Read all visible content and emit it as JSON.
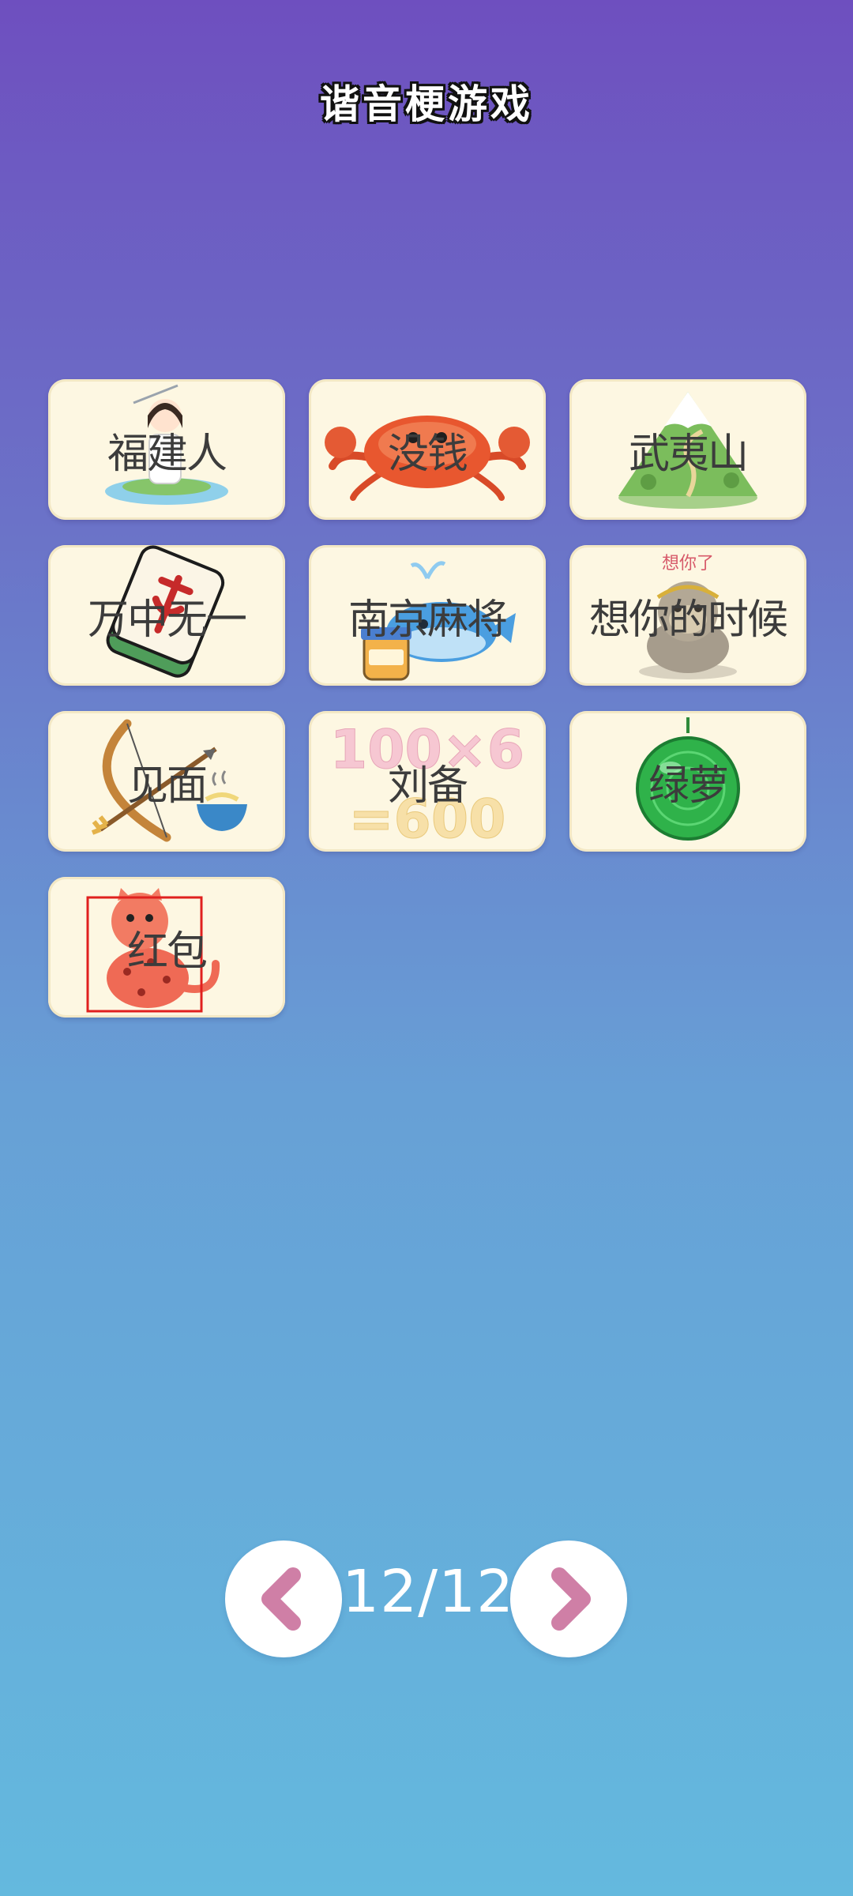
{
  "app": {
    "title": "谐音梗游戏"
  },
  "cards": [
    {
      "label": "福建人",
      "icon": "swordswoman-on-island-icon"
    },
    {
      "label": "没钱",
      "icon": "crab-icon"
    },
    {
      "label": "武夷山",
      "icon": "mountain-icon"
    },
    {
      "label": "万中无一",
      "icon": "mahjong-tile-icon"
    },
    {
      "label": "南京麻将",
      "icon": "whale-sesame-paste-icon"
    },
    {
      "label": "想你的时候",
      "icon": "stone-monkey-icon",
      "picture_text": "想你了"
    },
    {
      "label": "见面",
      "icon": "bow-arrow-noodles-icon"
    },
    {
      "label": "刘备",
      "icon": "math-equation-icon",
      "picture_text": "100×6 =600"
    },
    {
      "label": "绿萝",
      "icon": "green-gong-icon"
    },
    {
      "label": "红包",
      "icon": "red-leopard-icon"
    }
  ],
  "pagination": {
    "indicator": "12/12",
    "prev_icon": "chevron-left-icon",
    "next_icon": "chevron-right-icon"
  },
  "colors": {
    "background_top": "#6e4fbf",
    "background_bottom": "#64b9de",
    "card_background": "#fdf7e2",
    "chevron": "#cf7fa6"
  }
}
